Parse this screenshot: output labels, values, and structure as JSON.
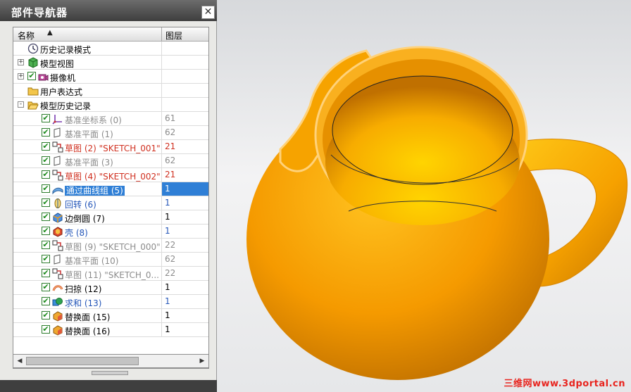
{
  "panel": {
    "title": "部件导航器",
    "close_label": "✕",
    "columns": {
      "name": "名称",
      "layer": "图层"
    }
  },
  "tree": [
    {
      "label": "历史记录模式",
      "layer": "",
      "color": "black",
      "icon": "clock-icon",
      "expander": "",
      "check": false,
      "indent": 1
    },
    {
      "label": "模型视图",
      "layer": "",
      "color": "black",
      "icon": "model-views-icon",
      "expander": "+",
      "check": false,
      "indent": 1
    },
    {
      "label": "摄像机",
      "layer": "",
      "color": "black",
      "icon": "camera-icon",
      "expander": "+",
      "check": true,
      "indent": 1
    },
    {
      "label": "用户表达式",
      "layer": "",
      "color": "black",
      "icon": "folder-icon",
      "expander": "",
      "check": false,
      "indent": 1
    },
    {
      "label": "模型历史记录",
      "layer": "",
      "color": "black",
      "icon": "folder-open-icon",
      "expander": "-",
      "check": false,
      "indent": 1
    },
    {
      "label": "基准坐标系 (0)",
      "layer": "61",
      "color": "gray",
      "icon": "datum-csys-icon",
      "expander": "",
      "check": true,
      "indent": 2
    },
    {
      "label": "基准平面 (1)",
      "layer": "62",
      "color": "gray",
      "icon": "datum-plane-icon",
      "expander": "",
      "check": true,
      "indent": 2
    },
    {
      "label": "草图 (2) \"SKETCH_001\"",
      "layer": "21",
      "color": "red",
      "icon": "sketch-icon",
      "expander": "",
      "check": true,
      "indent": 2
    },
    {
      "label": "基准平面 (3)",
      "layer": "62",
      "color": "gray",
      "icon": "datum-plane-icon",
      "expander": "",
      "check": true,
      "indent": 2
    },
    {
      "label": "草图 (4) \"SKETCH_002\"",
      "layer": "21",
      "color": "red",
      "icon": "sketch-icon",
      "expander": "",
      "check": true,
      "indent": 2
    },
    {
      "label": "通过曲线组 (5)",
      "layer": "1",
      "color": "black",
      "icon": "through-curves-icon",
      "expander": "",
      "check": true,
      "indent": 2,
      "selected": true
    },
    {
      "label": "回转 (6)",
      "layer": "1",
      "color": "blue",
      "icon": "revolve-icon",
      "expander": "",
      "check": true,
      "indent": 2
    },
    {
      "label": "边倒圆 (7)",
      "layer": "1",
      "color": "black",
      "icon": "edge-blend-icon",
      "expander": "",
      "check": true,
      "indent": 2
    },
    {
      "label": "壳 (8)",
      "layer": "1",
      "color": "blue",
      "icon": "shell-icon",
      "expander": "",
      "check": true,
      "indent": 2
    },
    {
      "label": "草图 (9) \"SKETCH_000\"",
      "layer": "22",
      "color": "gray",
      "icon": "sketch-icon",
      "expander": "",
      "check": true,
      "indent": 2
    },
    {
      "label": "基准平面 (10)",
      "layer": "62",
      "color": "gray",
      "icon": "datum-plane-icon",
      "expander": "",
      "check": true,
      "indent": 2
    },
    {
      "label": "草图 (11) \"SKETCH_0...",
      "layer": "22",
      "color": "gray",
      "icon": "sketch-icon",
      "expander": "",
      "check": true,
      "indent": 2
    },
    {
      "label": "扫掠 (12)",
      "layer": "1",
      "color": "black",
      "icon": "swept-icon",
      "expander": "",
      "check": true,
      "indent": 2
    },
    {
      "label": "求和 (13)",
      "layer": "1",
      "color": "blue",
      "icon": "unite-icon",
      "expander": "",
      "check": true,
      "indent": 2
    },
    {
      "label": "替换面 (15)",
      "layer": "1",
      "color": "black",
      "icon": "replace-face-icon",
      "expander": "",
      "check": true,
      "indent": 2
    },
    {
      "label": "替换面 (16)",
      "layer": "1",
      "color": "black",
      "icon": "replace-face-icon",
      "expander": "",
      "check": true,
      "indent": 2
    }
  ],
  "model": {
    "name": "teapot-3d-model",
    "color": "#f5a000"
  },
  "watermark": "三维网www.3dportal.cn",
  "colors": {
    "selection": "#2f7fd6",
    "gray": "#8c8c8c",
    "red": "#d03020",
    "blue": "#2456b8"
  }
}
